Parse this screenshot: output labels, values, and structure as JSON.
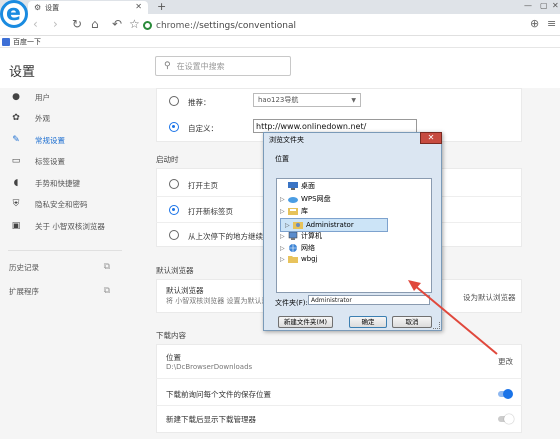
{
  "tab": {
    "title": "设置"
  },
  "omnibox": {
    "scheme": "chrome://",
    "path": "settings/conventional"
  },
  "bookmarks": {
    "item": "百度一下"
  },
  "header": {
    "title": "设置",
    "search_placeholder": "在设置中搜索"
  },
  "sidebar": {
    "items": [
      {
        "label": "用户",
        "icon": "person-icon"
      },
      {
        "label": "外观",
        "icon": "palette-icon"
      },
      {
        "label": "常规设置",
        "icon": "wrench-icon",
        "active": true
      },
      {
        "label": "标签设置",
        "icon": "tab-icon"
      },
      {
        "label": "手势和快捷键",
        "icon": "mouse-icon"
      },
      {
        "label": "隐私安全和密码",
        "icon": "shield-icon"
      },
      {
        "label": "关于 小智双核浏览器",
        "icon": "info-icon"
      }
    ],
    "links": [
      {
        "label": "历史记录",
        "icon": "external-link-icon"
      },
      {
        "label": "扩展程序",
        "icon": "external-link-icon"
      }
    ]
  },
  "homepage": {
    "recommend_label": "推荐：",
    "recommend_value": "hao123导航",
    "custom_label": "自定义：",
    "custom_url": "http://www.onlinedown.net/"
  },
  "startup": {
    "label": "启动时",
    "options": [
      "打开主页",
      "打开新标签页",
      "从上次停下的地方继续"
    ],
    "selected": 1
  },
  "default_browser": {
    "section": "默认浏览器",
    "title": "默认浏览器",
    "desc": "将 小智双核浏览器 设置为默认浏览",
    "action": "设为默认浏览器"
  },
  "downloads": {
    "section": "下载内容",
    "location_label": "位置",
    "location_path": "D:\\DcBrowserDownloads",
    "change": "更改",
    "ask_label": "下载前询问每个文件的保存位置",
    "ask_on": true,
    "show_mgr_label": "新建下载后显示下载管理器",
    "show_mgr_on": false
  },
  "dialog": {
    "title": "浏览文件夹",
    "location": "位置",
    "tree": [
      {
        "label": "桌面",
        "icon": "desktop-icon"
      },
      {
        "label": "WPS网盘",
        "icon": "cloud-drive-icon"
      },
      {
        "label": "库",
        "icon": "library-icon"
      },
      {
        "label": "Administrator",
        "icon": "user-folder-icon",
        "selected": true
      },
      {
        "label": "计算机",
        "icon": "computer-icon"
      },
      {
        "label": "网络",
        "icon": "network-icon"
      },
      {
        "label": "wbgj",
        "icon": "folder-icon"
      }
    ],
    "folder_label": "文件夹(F):",
    "folder_value": "Administrator",
    "btn_new": "新建文件夹(M)",
    "btn_ok": "确定",
    "btn_cancel": "取消"
  },
  "colors": {
    "accent": "#1a73e8",
    "annotation_arrow": "#e0483c"
  }
}
